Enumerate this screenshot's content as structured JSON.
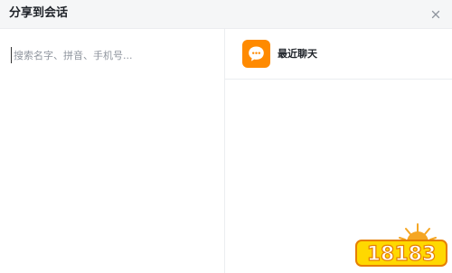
{
  "dialog": {
    "title": "分享到会话",
    "close_icon": "close-icon"
  },
  "search": {
    "placeholder": "搜索名字、拼音、手机号..."
  },
  "recent": {
    "label": "最近聊天",
    "icon": "chat-bubble-icon",
    "icon_color": "#ff8a00"
  },
  "watermark": {
    "text": "18183",
    "icon": "logo-watermark"
  }
}
